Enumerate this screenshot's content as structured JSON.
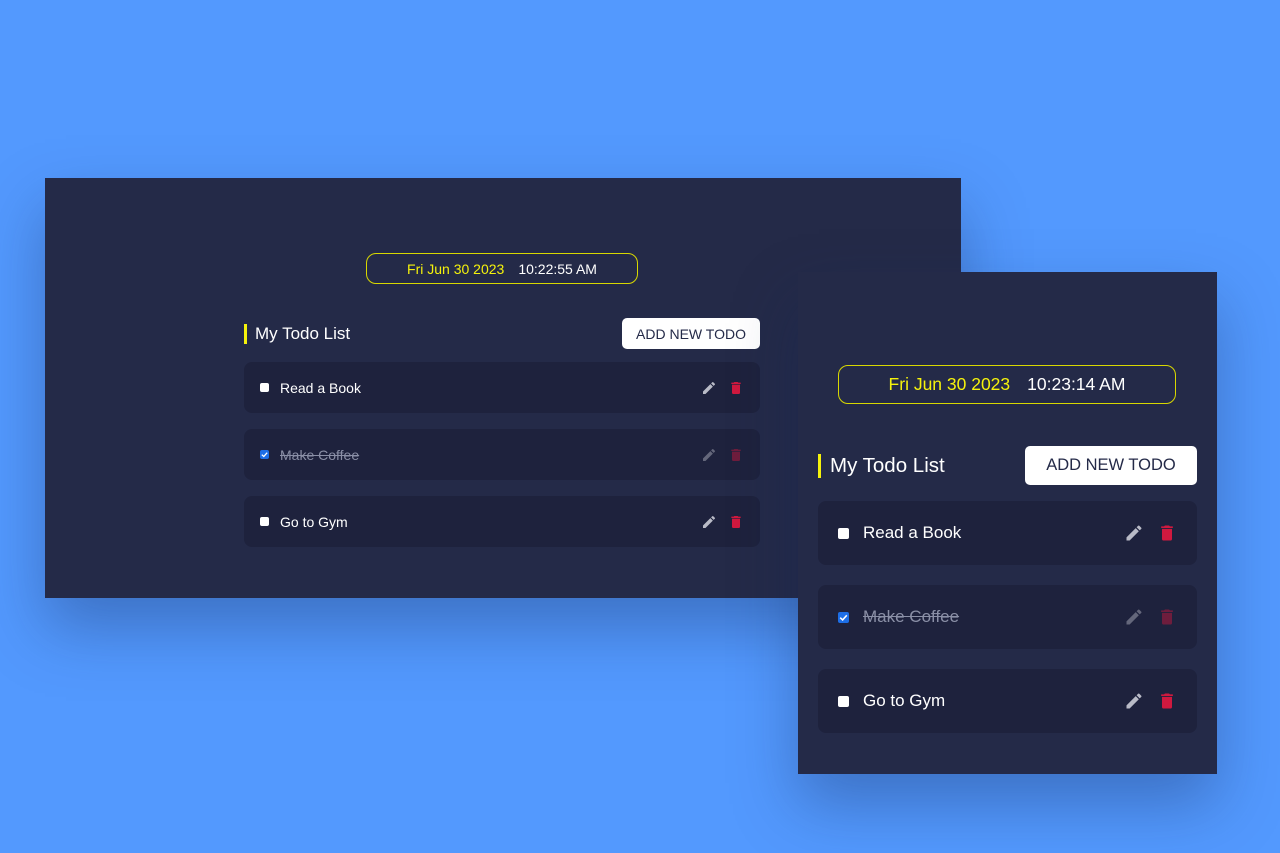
{
  "app": {
    "date": "Fri Jun 30 2023",
    "title": "My Todo List",
    "add_button_label": "ADD NEW TODO"
  },
  "large_view": {
    "time": "10:22:55 AM",
    "todos": [
      {
        "text": "Read a Book",
        "completed": false
      },
      {
        "text": "Make Coffee",
        "completed": true
      },
      {
        "text": "Go to Gym",
        "completed": false
      }
    ]
  },
  "small_view": {
    "time": "10:23:14 AM",
    "todos": [
      {
        "text": "Read a Book",
        "completed": false
      },
      {
        "text": "Make Coffee",
        "completed": true
      },
      {
        "text": "Go to Gym",
        "completed": false
      }
    ]
  },
  "icons": {
    "edit": "pencil-icon",
    "delete": "trash-icon",
    "check": "checkmark-icon"
  },
  "colors": {
    "background": "#5399fe",
    "panel": "#242a48",
    "todo_card": "#1e223d",
    "accent_yellow": "#f5f20c",
    "delete_red": "#d0193f",
    "edit_gray": "#b9bbc7",
    "checkbox_checked": "#1d6ee6"
  }
}
